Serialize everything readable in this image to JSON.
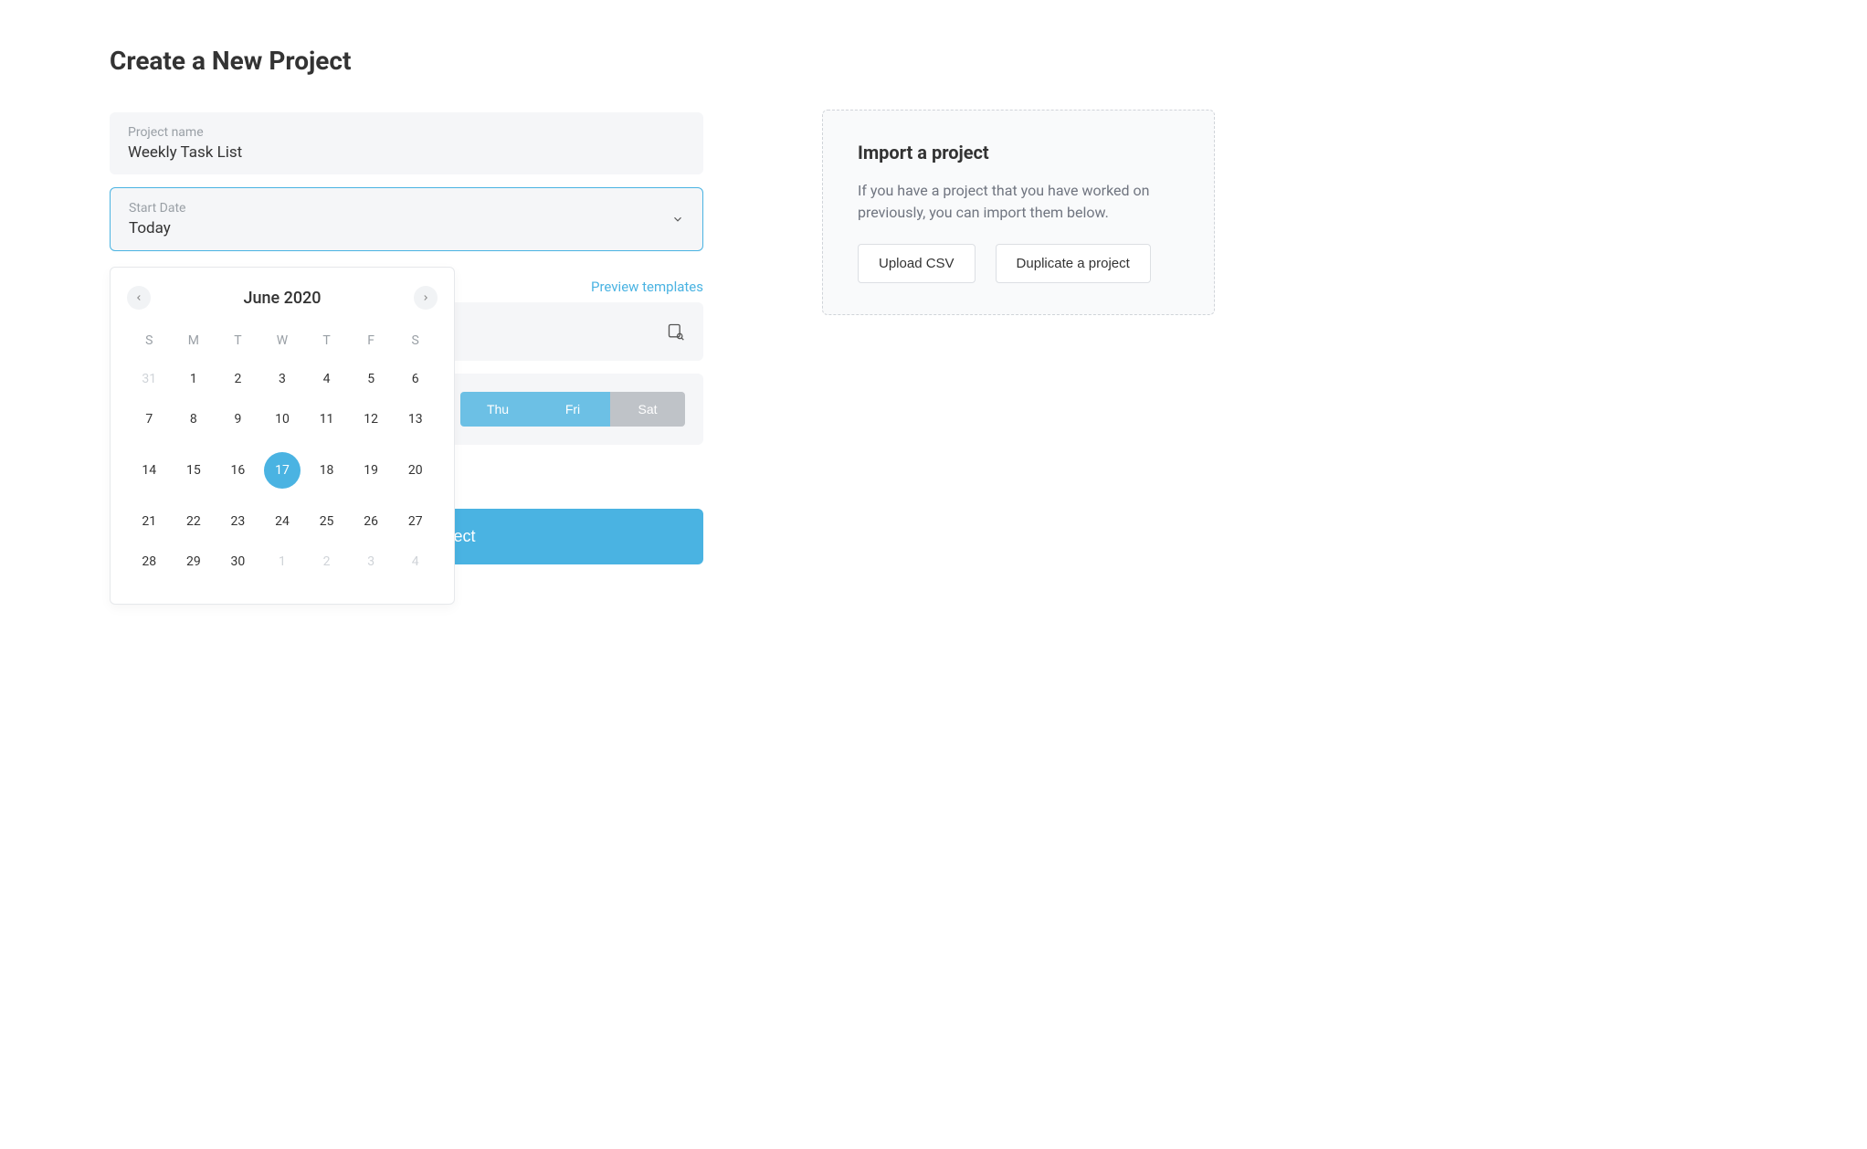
{
  "page": {
    "title": "Create a New Project"
  },
  "form": {
    "project_name": {
      "label": "Project name",
      "value": "Weekly Task List"
    },
    "start_date": {
      "label": "Start Date",
      "value": "Today"
    },
    "preview_link": "Preview templates",
    "days": [
      {
        "label": "Thu",
        "active": true
      },
      {
        "label": "Fri",
        "active": true
      },
      {
        "label": "Sat",
        "active": false
      }
    ],
    "submit": "Create new project"
  },
  "calendar": {
    "month": "June 2020",
    "dow": [
      "S",
      "M",
      "T",
      "W",
      "T",
      "F",
      "S"
    ],
    "weeks": [
      [
        {
          "d": "31",
          "muted": true
        },
        {
          "d": "1"
        },
        {
          "d": "2"
        },
        {
          "d": "3"
        },
        {
          "d": "4"
        },
        {
          "d": "5"
        },
        {
          "d": "6"
        }
      ],
      [
        {
          "d": "7"
        },
        {
          "d": "8"
        },
        {
          "d": "9"
        },
        {
          "d": "10"
        },
        {
          "d": "11"
        },
        {
          "d": "12"
        },
        {
          "d": "13"
        }
      ],
      [
        {
          "d": "14"
        },
        {
          "d": "15"
        },
        {
          "d": "16"
        },
        {
          "d": "17",
          "selected": true
        },
        {
          "d": "18"
        },
        {
          "d": "19"
        },
        {
          "d": "20"
        }
      ],
      [
        {
          "d": "21"
        },
        {
          "d": "22"
        },
        {
          "d": "23"
        },
        {
          "d": "24"
        },
        {
          "d": "25"
        },
        {
          "d": "26"
        },
        {
          "d": "27"
        }
      ],
      [
        {
          "d": "28"
        },
        {
          "d": "29"
        },
        {
          "d": "30"
        },
        {
          "d": "1",
          "muted": true
        },
        {
          "d": "2",
          "muted": true
        },
        {
          "d": "3",
          "muted": true
        },
        {
          "d": "4",
          "muted": true
        }
      ]
    ]
  },
  "import": {
    "title": "Import a project",
    "description": "If you have a project that you have worked on previously, you can import them below.",
    "upload_btn": "Upload CSV",
    "duplicate_btn": "Duplicate a project"
  }
}
